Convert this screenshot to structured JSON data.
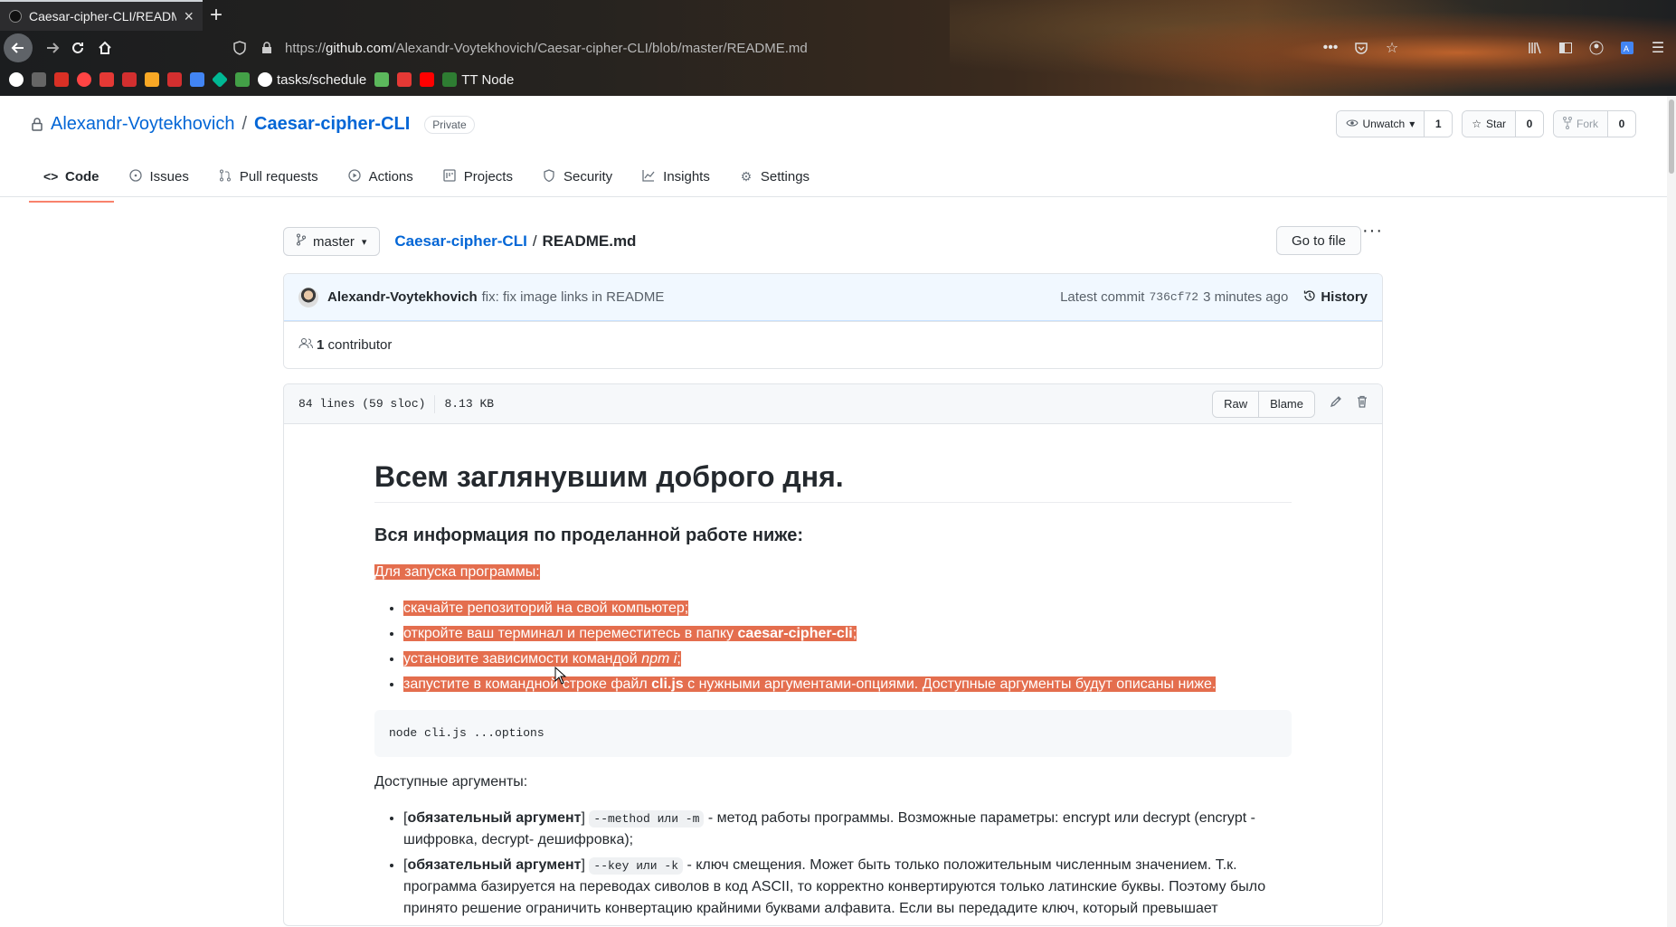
{
  "browser": {
    "tab_title": "Caesar-cipher-CLI/READM",
    "url_prefix": "https://",
    "url_domain": "github.com",
    "url_path": "/Alexandr-Voytekhovich/Caesar-cipher-CLI/blob/master/README.md",
    "bookmarks": [
      {
        "label": "",
        "color": "#ffffff"
      },
      {
        "label": "",
        "color": "#666666"
      },
      {
        "label": "",
        "color": "#d93025"
      },
      {
        "label": "",
        "color": "#ff4444"
      },
      {
        "label": "",
        "color": "#e53935"
      },
      {
        "label": "",
        "color": "#d32f2f"
      },
      {
        "label": "",
        "color": "#f9a825"
      },
      {
        "label": "",
        "color": "#d32f2f"
      },
      {
        "label": "",
        "color": "#4285f4"
      },
      {
        "label": "",
        "color": "#00b894"
      },
      {
        "label": "",
        "color": "#43a047"
      },
      {
        "label": "tasks/schedule",
        "color": "#ffffff"
      },
      {
        "label": "",
        "color": "#5cb85c"
      },
      {
        "label": "",
        "color": "#e53935"
      },
      {
        "label": "",
        "color": "#ff0000"
      },
      {
        "label": "TT Node",
        "color": "#2e7d32"
      }
    ]
  },
  "repo": {
    "owner": "Alexandr-Voytekhovich",
    "separator": "/",
    "name": "Caesar-cipher-CLI",
    "visibility": "Private",
    "unwatch_label": "Unwatch",
    "watch_count": "1",
    "star_label": "Star",
    "star_count": "0",
    "fork_label": "Fork",
    "fork_count": "0"
  },
  "repo_nav": [
    {
      "label": "Code",
      "icon": "code-icon"
    },
    {
      "label": "Issues",
      "icon": "issue-icon"
    },
    {
      "label": "Pull requests",
      "icon": "pull-request-icon"
    },
    {
      "label": "Actions",
      "icon": "play-icon"
    },
    {
      "label": "Projects",
      "icon": "project-icon"
    },
    {
      "label": "Security",
      "icon": "shield-icon"
    },
    {
      "label": "Insights",
      "icon": "graph-icon"
    },
    {
      "label": "Settings",
      "icon": "gear-icon"
    }
  ],
  "file_nav": {
    "branch": "master",
    "crumb_repo": "Caesar-cipher-CLI",
    "crumb_sep": "/",
    "crumb_file": "README.md",
    "goto_label": "Go to file"
  },
  "commit": {
    "author": "Alexandr-Voytekhovich",
    "message": "fix: fix image links in README",
    "latest_label": "Latest commit",
    "sha": "736cf72",
    "time": "3 minutes ago",
    "history_label": "History",
    "contributors_count": "1",
    "contributors_label": "contributor"
  },
  "file": {
    "lines": "84 lines (59 sloc)",
    "size": "8.13 KB",
    "raw_label": "Raw",
    "blame_label": "Blame"
  },
  "readme": {
    "h1": "Всем заглянувшим доброго дня.",
    "h3": "Вся информация по проделанной работе ниже:",
    "intro": "Для запуска программы:",
    "steps": {
      "s1": "скачайте репозиторий на свой компьютер;",
      "s2_pre": "откройте ваш терминал и переместитесь в папку ",
      "s2_bold": "caesar-cipher-cli",
      "s2_post": ";",
      "s3_pre": "установите зависимости командой ",
      "s3_em": "npm i",
      "s3_post": ";",
      "s4_pre": "запустите в командной строке файл ",
      "s4_bold": "cli.js",
      "s4_post": " с нужными аргументами-опциями. Доступные аргументы будут описаны ниже."
    },
    "code": "node cli.js ...options",
    "args_title": "Доступные аргументы:",
    "arg1_open": "[",
    "arg1_bold": "обязательный аргумент",
    "arg1_close": "]",
    "arg1_code": "--method или -m",
    "arg1_text": " - метод работы программы. Возможные параметры: encrypt или decrypt (encrypt - шифровка, decrypt- дешифровка);",
    "arg2_open": "[",
    "arg2_bold": "обязательный аргумент",
    "arg2_close": "]",
    "arg2_code": "--key или -k",
    "arg2_text": " - ключ смещения. Может быть только положительным численным значением. Т.к. программа базируется на переводах сиволов в код ASCII, то корректно конвертируются только латинские буквы. Поэтому было принято решение ограничить конвертацию крайними буквами алфавита. Если вы передадите ключ, который превышает"
  }
}
